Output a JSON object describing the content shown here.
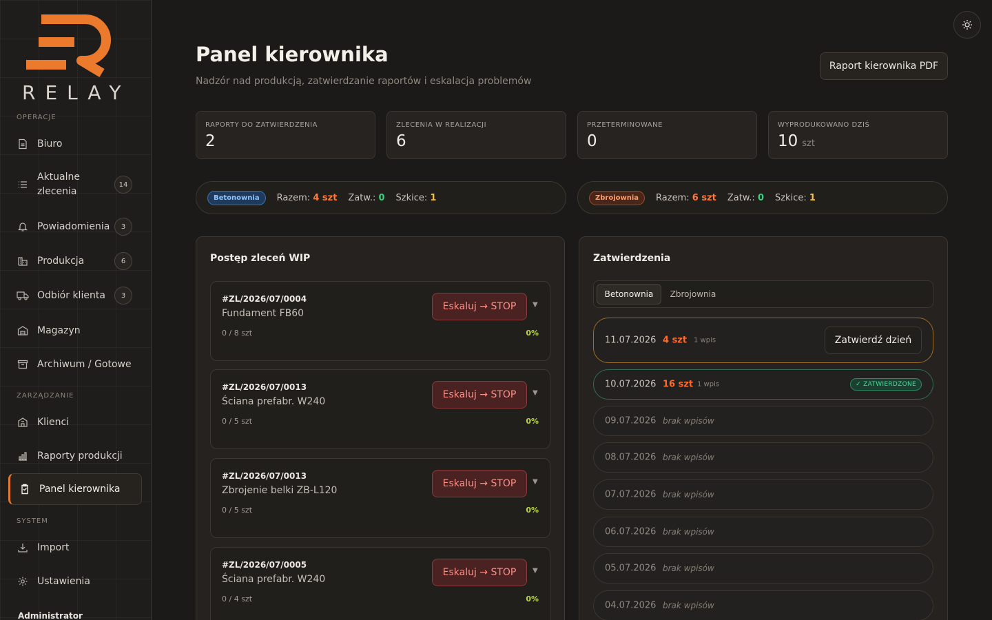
{
  "brand": {
    "name": "RELAY",
    "accent": "#e0782f"
  },
  "sidebar": {
    "sections": {
      "operations": "OPERACJE",
      "management": "ZARZĄDZANIE",
      "system": "SYSTEM"
    },
    "items": [
      {
        "label": "Biuro",
        "icon": "document-icon"
      },
      {
        "label": "Aktualne zlecenia",
        "icon": "list-icon",
        "badge": "14"
      },
      {
        "label": "Powiadomienia",
        "icon": "bell-icon",
        "badge": "3"
      },
      {
        "label": "Produkcja",
        "icon": "factory-icon",
        "badge": "6"
      },
      {
        "label": "Odbiór klienta",
        "icon": "truck-icon",
        "badge": "3"
      },
      {
        "label": "Magazyn",
        "icon": "warehouse-icon"
      },
      {
        "label": "Archiwum / Gotowe",
        "icon": "archive-icon"
      },
      {
        "label": "Klienci",
        "icon": "building-icon"
      },
      {
        "label": "Raporty produkcji",
        "icon": "bar-chart-icon"
      },
      {
        "label": "Panel kierownika",
        "icon": "clipboard-icon",
        "active": true
      },
      {
        "label": "Import",
        "icon": "download-icon"
      },
      {
        "label": "Ustawienia",
        "icon": "gear-icon"
      }
    ],
    "user": "Administrator"
  },
  "header": {
    "title": "Panel kierownika",
    "subtitle": "Nadzór nad produkcją, zatwierdzanie raportów i eskalacja problemów",
    "pdf_button": "Raport kierownika PDF"
  },
  "stats": [
    {
      "label": "RAPORTY DO ZATWIERDZENIA",
      "value": "2"
    },
    {
      "label": "ZLECENIA W REALIZACJI",
      "value": "6"
    },
    {
      "label": "PRZETERMINOWANE",
      "value": "0"
    },
    {
      "label": "WYPRODUKOWANO DZIŚ",
      "value": "10",
      "unit": "szt"
    }
  ],
  "summaries": [
    {
      "tag": "Betonownia",
      "total_label": "Razem:",
      "total": "4 szt",
      "approved_label": "Zatw.:",
      "approved": "0",
      "drafts_label": "Szkice:",
      "drafts": "1"
    },
    {
      "tag": "Zbrojownia",
      "total_label": "Razem:",
      "total": "6 szt",
      "approved_label": "Zatw.:",
      "approved": "0",
      "drafts_label": "Szkice:",
      "drafts": "1"
    }
  ],
  "wip": {
    "title": "Postęp zleceń WIP",
    "escalate_label": "Eskaluj → STOP",
    "orders": [
      {
        "id": "#ZL/2026/07/0004",
        "name": "Fundament FB60",
        "qty": "0 / 8 szt",
        "pct": "0%"
      },
      {
        "id": "#ZL/2026/07/0013",
        "name": "Ściana prefabr. W240",
        "qty": "0 / 5 szt",
        "pct": "0%"
      },
      {
        "id": "#ZL/2026/07/0013",
        "name": "Zbrojenie belki ZB-L120",
        "qty": "0 / 5 szt",
        "pct": "0%"
      },
      {
        "id": "#ZL/2026/07/0005",
        "name": "Ściana prefabr. W240",
        "qty": "0 / 4 szt",
        "pct": "0%"
      }
    ]
  },
  "approvals": {
    "title": "Zatwierdzenia",
    "tabs": [
      "Betonownia",
      "Zbrojownia"
    ],
    "approve_button": "Zatwierdź dzień",
    "approved_badge": "✓ ZATWIERDZONE",
    "no_entries": "brak wpisów",
    "days": [
      {
        "date": "11.07.2026",
        "qty": "4 szt",
        "entries": "1 wpis",
        "status": "pending"
      },
      {
        "date": "10.07.2026",
        "qty": "16 szt",
        "entries": "1 wpis",
        "status": "approved"
      },
      {
        "date": "09.07.2026",
        "status": "empty"
      },
      {
        "date": "08.07.2026",
        "status": "empty"
      },
      {
        "date": "07.07.2026",
        "status": "empty"
      },
      {
        "date": "06.07.2026",
        "status": "empty"
      },
      {
        "date": "05.07.2026",
        "status": "empty"
      },
      {
        "date": "04.07.2026",
        "status": "empty"
      }
    ]
  }
}
